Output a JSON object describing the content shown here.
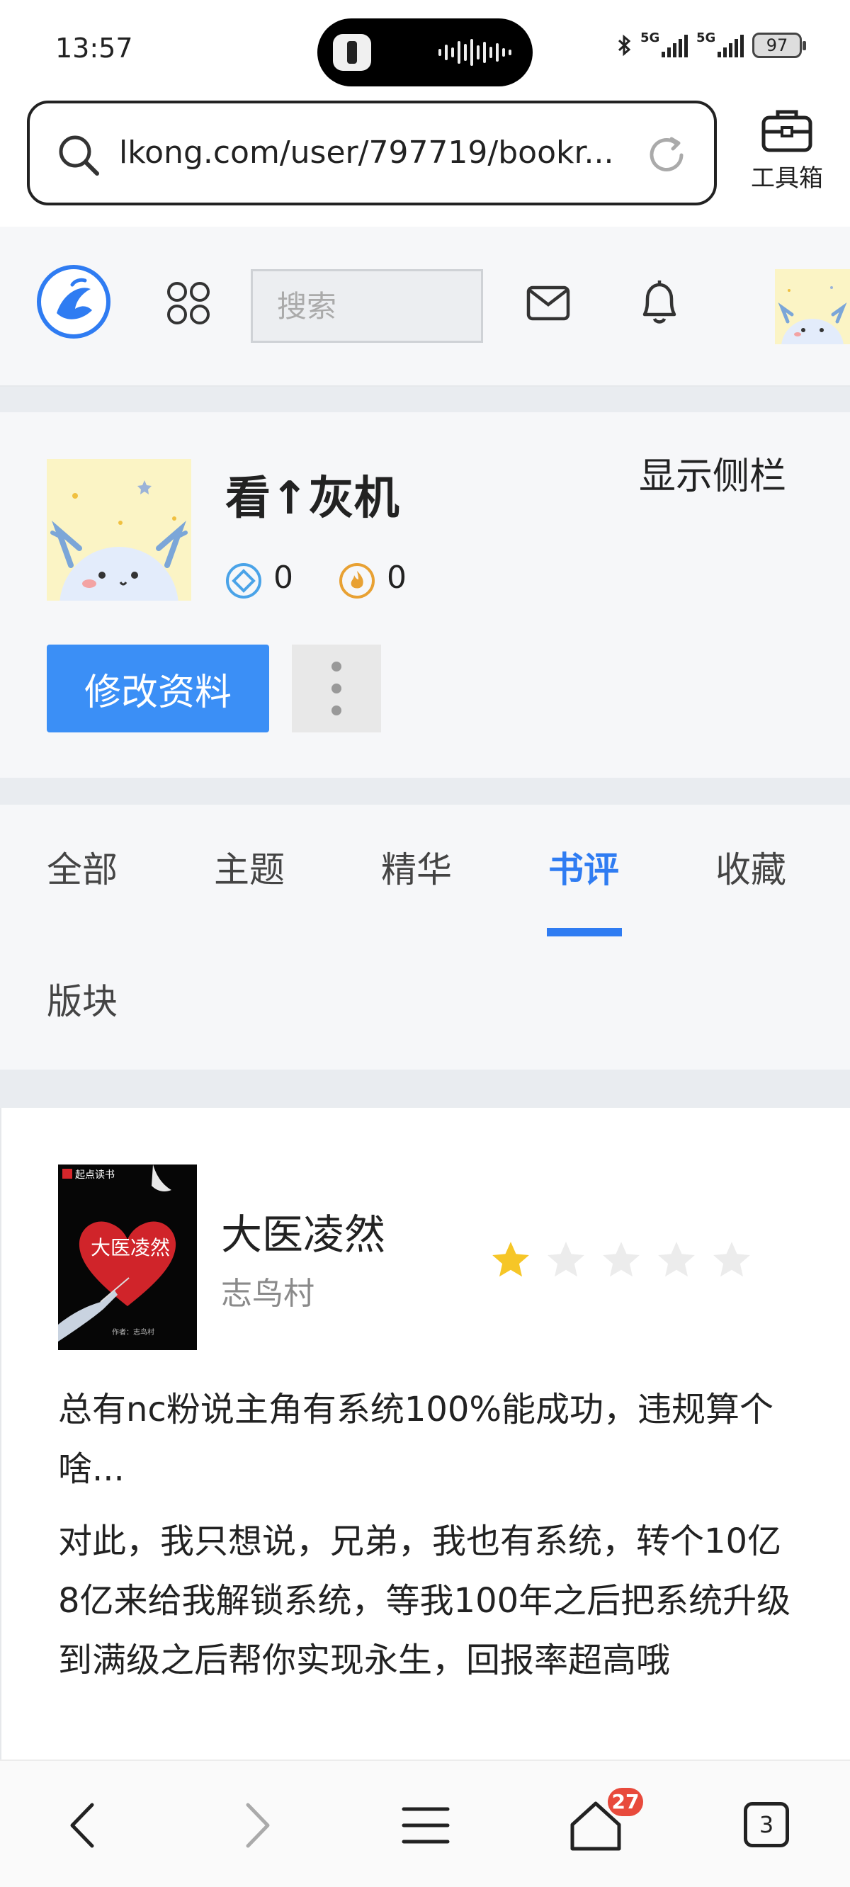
{
  "status_bar": {
    "time": "13:57",
    "signal1": "5G",
    "signal2": "5G",
    "battery": "97"
  },
  "browser": {
    "url": "lkong.com/user/797719/bookr...",
    "toolbox_label": "工具箱"
  },
  "site_header": {
    "search_placeholder": "搜索"
  },
  "profile": {
    "username": "看↑灰机",
    "sidebar_toggle": "显示侧栏",
    "stat1_value": "0",
    "stat2_value": "0",
    "edit_button": "修改资料"
  },
  "tabs": [
    {
      "label": "全部"
    },
    {
      "label": "主题"
    },
    {
      "label": "精华"
    },
    {
      "label": "书评",
      "active": true
    },
    {
      "label": "收藏"
    },
    {
      "label": "版块"
    }
  ],
  "review": {
    "cover_brand": "起点读书",
    "cover_title": "大医凌然",
    "cover_author": "作者：志鸟村",
    "book_title": "大医凌然",
    "author": "志鸟村",
    "rating": 1,
    "rating_max": 5,
    "paragraph1": "总有nc粉说主角有系统100%能成功，违规算个啥...",
    "paragraph2": "对此，我只想说，兄弟，我也有系统，转个10亿8亿来给我解锁系统，等我100年之后把系统升级到满级之后帮你实现永生，回报率超高哦"
  },
  "bottom_nav": {
    "tabs_badge": "27",
    "windows_count": "3"
  },
  "colors": {
    "accent_blue": "#2f7cf2",
    "button_blue": "#3b8ff6",
    "star_gold": "#f6c627",
    "badge_red": "#e84a3c"
  }
}
